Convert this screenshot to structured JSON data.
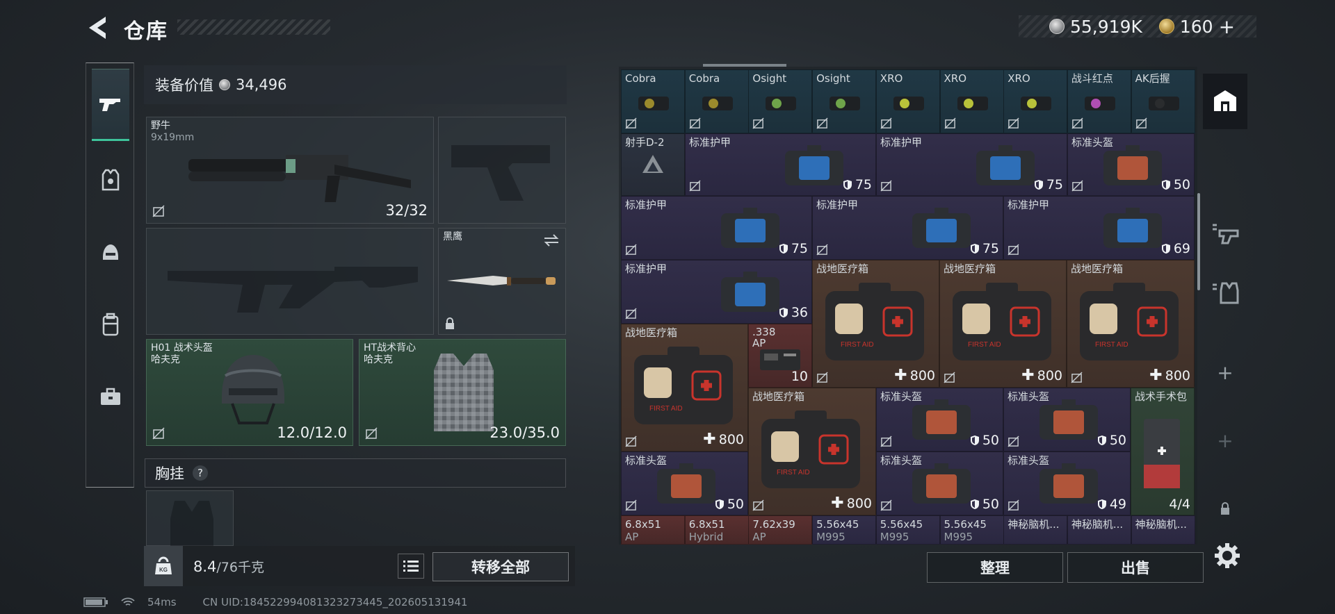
{
  "header": {
    "title": "仓库"
  },
  "currency": {
    "silver": "55,919K",
    "gold": "160",
    "gold_add": "+"
  },
  "equip": {
    "value_label": "装备价值",
    "value": "34,496",
    "primary": {
      "name": "野牛",
      "ammo": "9x19mm",
      "value": "32/32"
    },
    "pistol": {
      "name": ""
    },
    "knife": {
      "name": "黑鹰"
    },
    "helmet": {
      "name": "H01 战术头盔",
      "maker": "哈夫克",
      "value": "12.0/12.0"
    },
    "vest": {
      "name": "HT战术背心",
      "maker": "哈夫克",
      "value": "23.0/35.0"
    },
    "chest_rig": {
      "label": "胸挂",
      "help": "?"
    }
  },
  "weight": {
    "value": "8.4",
    "max": "/76千克"
  },
  "buttons": {
    "transfer_all": "转移全部",
    "sort": "整理",
    "sell": "出售"
  },
  "status": {
    "ping": "54ms",
    "uid": "CN UID:18452299408132327​3445_202605131941"
  },
  "grid": {
    "row1": [
      "Cobra",
      "Cobra",
      "Osight",
      "Osight",
      "XRO",
      "XRO",
      "XRO",
      "战斗红点",
      "AK后握"
    ],
    "shooter": "射手D-2",
    "armor_label": "标准护甲",
    "helmet_label": "标准头盔",
    "medkit_label": "战地医疗箱",
    "surgical_label": "战术手术包",
    "ammo338": ".338\nAP",
    "armor_vals": [
      "75",
      "75",
      "50",
      "75",
      "75",
      "69",
      "36"
    ],
    "medkit_vals": [
      "800",
      "800",
      "800",
      "800",
      "800"
    ],
    "ammo_val": "10",
    "helmet_vals": [
      "50",
      "50",
      "50",
      "50",
      "49"
    ],
    "surgical_val": "4/4",
    "bottom_row": [
      "6.8x51",
      "6.8x51",
      "7.62x39",
      "5.56x45",
      "5.56x45",
      "5.56x45",
      "神秘脑机...",
      "神秘脑机...",
      "神秘脑机..."
    ],
    "bottom_sub": [
      "AP",
      "Hybrid",
      "AP",
      "M995",
      "M995",
      "M995",
      "",
      "",
      ""
    ]
  },
  "colors": {
    "accent": "#3ec49b",
    "purple": "#322e49",
    "brown": "#4d3a30",
    "teal": "#203845"
  }
}
